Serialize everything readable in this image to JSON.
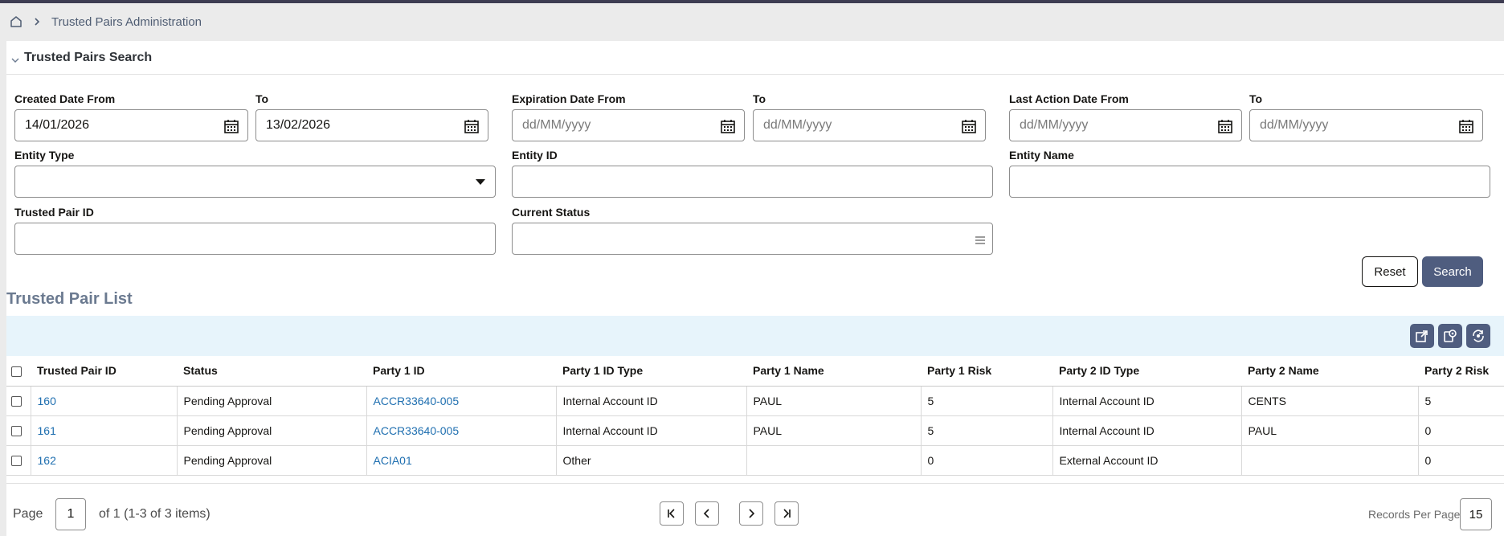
{
  "breadcrumb": {
    "current": "Trusted Pairs Administration"
  },
  "search_section": {
    "title": "Trusted Pairs Search"
  },
  "fields": {
    "created_from": {
      "label": "Created Date From",
      "value": "14/01/2026"
    },
    "created_to": {
      "label": "To",
      "value": "13/02/2026"
    },
    "expiration_from": {
      "label": "Expiration Date From",
      "placeholder": "dd/MM/yyyy"
    },
    "expiration_to": {
      "label": "To",
      "placeholder": "dd/MM/yyyy"
    },
    "last_action_from": {
      "label": "Last Action Date From",
      "placeholder": "dd/MM/yyyy"
    },
    "last_action_to": {
      "label": "To",
      "placeholder": "dd/MM/yyyy"
    },
    "entity_type": {
      "label": "Entity Type",
      "value": ""
    },
    "entity_id": {
      "label": "Entity ID",
      "value": ""
    },
    "entity_name": {
      "label": "Entity Name",
      "value": ""
    },
    "trusted_pair_id": {
      "label": "Trusted Pair ID",
      "value": ""
    },
    "current_status": {
      "label": "Current Status",
      "value": ""
    }
  },
  "buttons": {
    "reset": "Reset",
    "search": "Search"
  },
  "list": {
    "title": "Trusted Pair List",
    "columns": [
      "Trusted Pair ID",
      "Status",
      "Party 1 ID",
      "Party 1 ID Type",
      "Party 1 Name",
      "Party 1 Risk",
      "Party 2 ID Type",
      "Party 2 Name",
      "Party 2 Risk"
    ],
    "rows": [
      [
        "160",
        "Pending Approval",
        "ACCR33640-005",
        "Internal Account ID",
        "PAUL",
        "5",
        "Internal Account ID",
        "CENTS",
        "5"
      ],
      [
        "161",
        "Pending Approval",
        "ACCR33640-005",
        "Internal Account ID",
        "PAUL",
        "5",
        "Internal Account ID",
        "PAUL",
        "0"
      ],
      [
        "162",
        "Pending Approval",
        "ACIA01",
        "Other",
        "",
        "0",
        "External Account ID",
        "",
        "0"
      ]
    ]
  },
  "pagination": {
    "page_label": "Page",
    "page": "1",
    "summary": "of 1 (1-3 of 3 items)",
    "records_per_page_label": "Records Per Page",
    "records_per_page": "15"
  },
  "colors": {
    "primary_button": "#4f5d7f",
    "link": "#1f6fb0",
    "toolbar_bg": "#e7f4fb",
    "list_title": "#6b7a90"
  }
}
